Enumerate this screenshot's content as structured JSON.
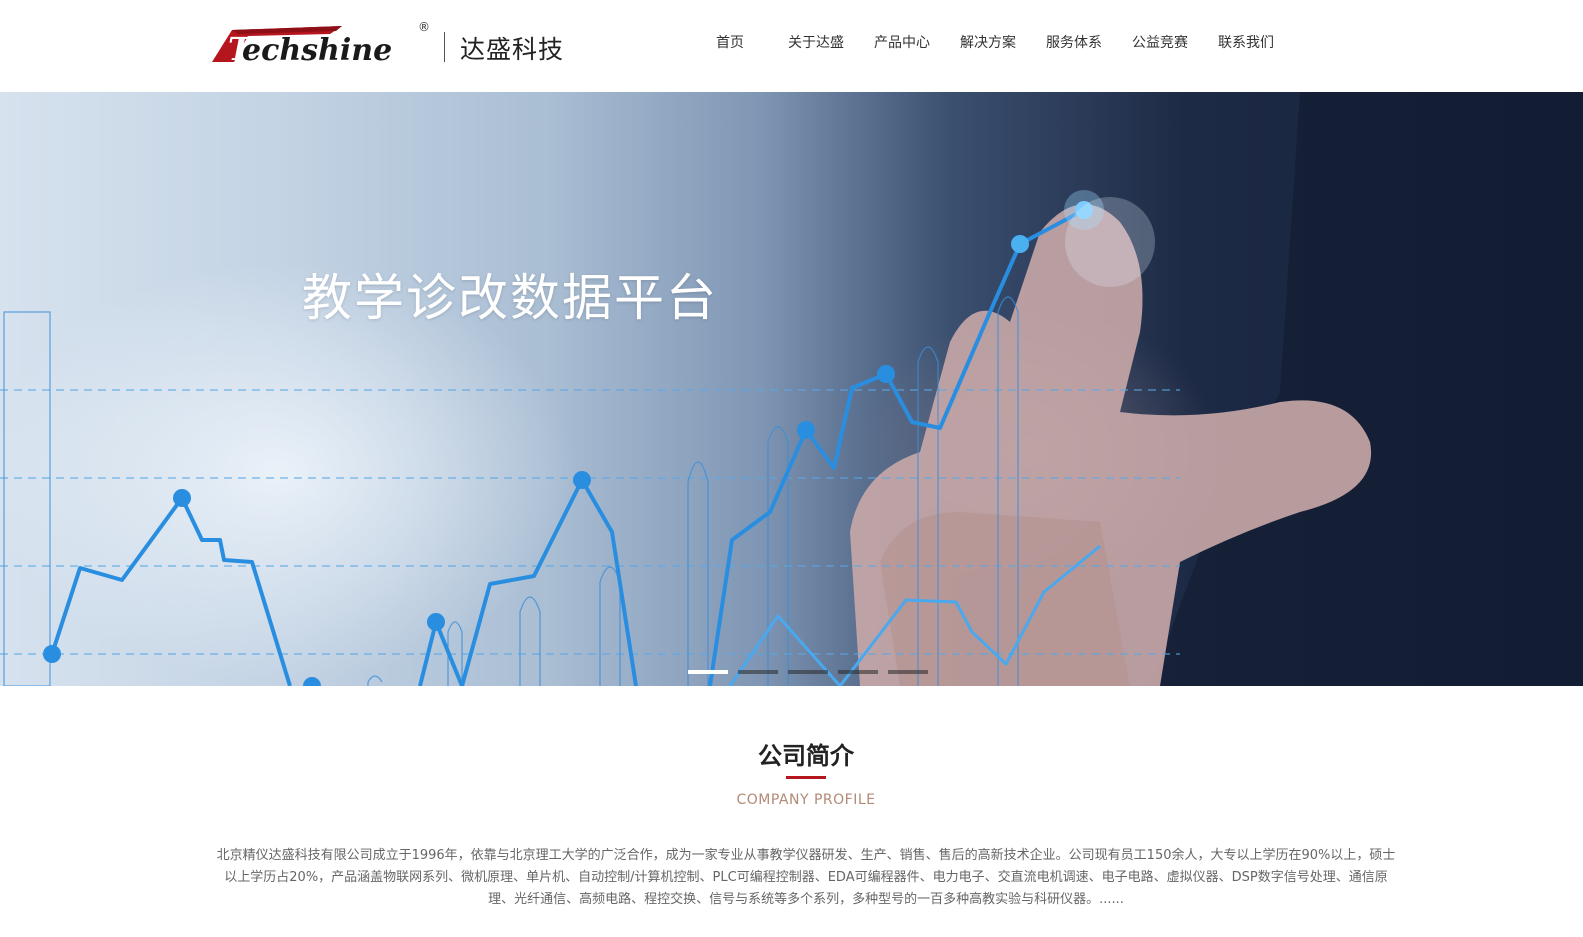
{
  "header": {
    "logo_text": "Techshine",
    "logo_reg": "®",
    "logo_cn": "达盛科技"
  },
  "nav": {
    "items": [
      {
        "label": "首页"
      },
      {
        "label": "关于达盛"
      },
      {
        "label": "产品中心"
      },
      {
        "label": "解决方案"
      },
      {
        "label": "服务体系"
      },
      {
        "label": "公益竞赛"
      },
      {
        "label": "联系我们"
      }
    ]
  },
  "banner": {
    "title": "教学诊改数据平台",
    "slides_count": 5,
    "active_slide": 1,
    "colors": {
      "line": "#2a8ee0",
      "accent": "#5ab8f5"
    }
  },
  "profile": {
    "title": "公司简介",
    "subtitle": "COMPANY PROFILE",
    "text": "北京精仪达盛科技有限公司成立于1996年，依靠与北京理工大学的广泛合作，成为一家专业从事教学仪器研发、生产、销售、售后的高新技术企业。公司现有员工150余人，大专以上学历在90%以上，硕士以上学历占20%，产品涵盖物联网系列、微机原理、单片机、自动控制/计算机控制、PLC可编程控制器、EDA可编程器件、电力电子、交直流电机调速、电子电路、虚拟仪器、DSP数字信号处理、通信原理、光纤通信、高频电路、程控交换、信号与系统等多个系列，多种型号的一百多种高教实验与科研仪器。......",
    "accent_color": "#b5161e"
  }
}
